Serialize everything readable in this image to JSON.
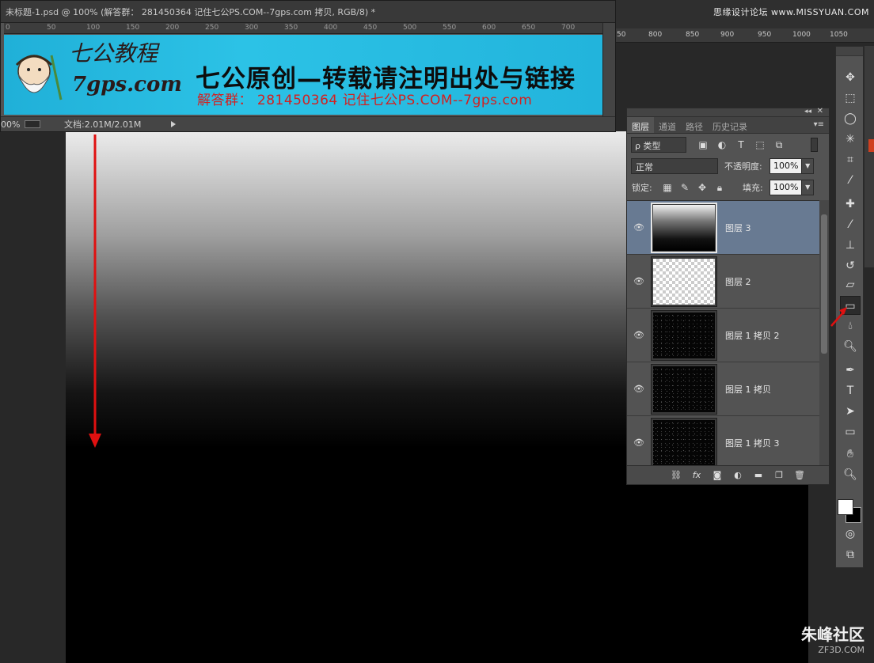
{
  "document": {
    "title": "未标题-1.psd @ 100% (解答群： 281450364   记住七公PS.COM--7gps.com 拷贝, RGB/8) *",
    "ruler_ticks": [
      "0",
      "50",
      "100",
      "150",
      "200",
      "250",
      "300",
      "350",
      "400",
      "450",
      "500",
      "550",
      "600",
      "650",
      "700"
    ],
    "zoom": "00%",
    "doc_info": "文档:2.01M/2.01M"
  },
  "banner": {
    "brand_cn": "七公教程",
    "brand_url": "7gps.com",
    "headline": "七公原创—转载请注明出处与链接",
    "subline": "解答群： 281450364     记住七公PS.COM--7gps.com"
  },
  "canvas_ruler_ticks": [
    "50",
    "800",
    "850",
    "900",
    "950",
    "1000",
    "1050"
  ],
  "watermark_top": "思缘设计论坛 www.MISSYUAN.COM",
  "layers_panel": {
    "tabs": [
      "图层",
      "通道",
      "路径",
      "历史记录"
    ],
    "filter_kind": "ρ 类型",
    "blend_mode": "正常",
    "opacity_label": "不透明度:",
    "opacity_value": "100%",
    "lock_label": "锁定:",
    "fill_label": "填充:",
    "fill_value": "100%",
    "layers": [
      {
        "name": "图层 3",
        "thumb": "gradient",
        "selected": true
      },
      {
        "name": "图层 2",
        "thumb": "transparent",
        "selected": false
      },
      {
        "name": "图层 1 拷贝 2",
        "thumb": "noise",
        "selected": false
      },
      {
        "name": "图层 1 拷贝",
        "thumb": "noise",
        "selected": false
      },
      {
        "name": "图层 1 拷贝 3",
        "thumb": "noise",
        "selected": false
      }
    ]
  },
  "tools": [
    "move-icon",
    "marquee-icon",
    "lasso-icon",
    "quick-select-icon",
    "crop-icon",
    "eyedropper-icon",
    "healing-icon",
    "brush-icon",
    "stamp-icon",
    "history-brush-icon",
    "eraser-icon",
    "gradient-icon",
    "blur-icon",
    "dodge-icon",
    "pen-icon",
    "type-icon",
    "path-select-icon",
    "rectangle-icon",
    "hand-icon",
    "zoom-icon"
  ],
  "active_tool": "gradient-icon",
  "watermark_bottom": {
    "cn": "朱峰社区",
    "url": "ZF3D.COM"
  },
  "colors": {
    "accent_arrow": "#e01010",
    "selected_layer": "#687a92",
    "banner": "#2cc2e6"
  }
}
